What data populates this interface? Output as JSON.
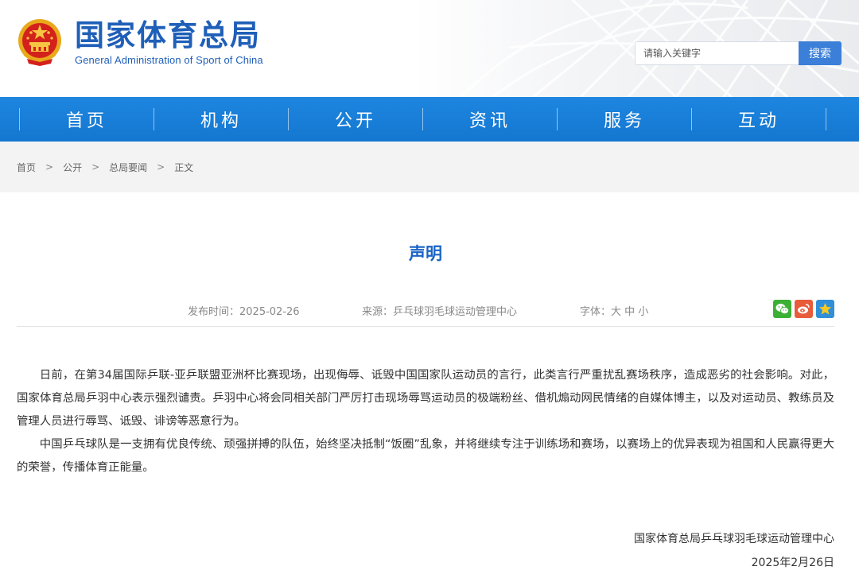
{
  "header": {
    "site_name_cn": "国家体育总局",
    "site_name_en": "General Administration of Sport of China",
    "search_placeholder": "请输入关键字",
    "search_button": "搜索"
  },
  "nav": {
    "items": [
      {
        "label": "首页"
      },
      {
        "label": "机构"
      },
      {
        "label": "公开"
      },
      {
        "label": "资讯"
      },
      {
        "label": "服务"
      },
      {
        "label": "互动"
      }
    ]
  },
  "breadcrumb": {
    "items": [
      "首页",
      "公开",
      "总局要闻"
    ],
    "separator": ">",
    "current": "正文"
  },
  "article": {
    "title": "声明",
    "publish_time": "发布时间：2025-02-26",
    "source": "来源：乒乓球羽毛球运动管理中心",
    "font_label": "字体：",
    "font_sizes": [
      "大",
      "中",
      "小"
    ],
    "share_icons": [
      "wechat-icon",
      "weibo-icon",
      "qzone-icon"
    ],
    "paragraphs": [
      "日前，在第34届国际乒联-亚乒联盟亚洲杯比赛现场，出现侮辱、诋毁中国国家队运动员的言行，此类言行严重扰乱赛场秩序，造成恶劣的社会影响。对此，国家体育总局乒羽中心表示强烈谴责。乒羽中心将会同相关部门严厉打击现场辱骂运动员的极端粉丝、借机煽动网民情绪的自媒体博主，以及对运动员、教练员及管理人员进行辱骂、诋毁、诽谤等恶意行为。",
      "中国乒乓球队是一支拥有优良传统、顽强拼搏的队伍，始终坚决抵制“饭圈”乱象，并将继续专注于训练场和赛场，以赛场上的优异表现为祖国和人民赢得更大的荣誉，传播体育正能量。"
    ],
    "signature_org": "国家体育总局乒乓球羽毛球运动管理中心",
    "signature_date": "2025年2月26日"
  },
  "colors": {
    "brand_blue": "#1f5fb8",
    "nav_blue": "#1477d0",
    "title_blue": "#1a63c4"
  }
}
